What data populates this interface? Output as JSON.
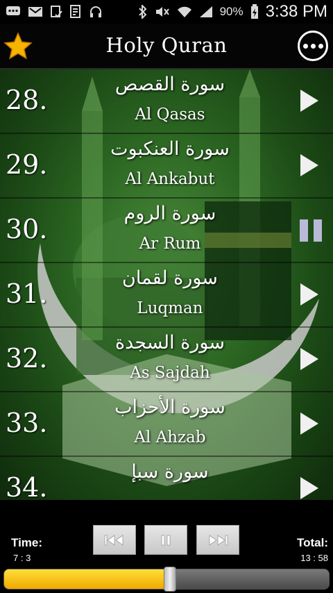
{
  "status_bar": {
    "left_icons": [
      "chat-icon",
      "gmail-icon",
      "task-icon",
      "document-icon",
      "headphones-icon"
    ],
    "right_icons": [
      "bluetooth-icon",
      "mute-icon",
      "wifi-icon",
      "signal-icon",
      "battery-icon"
    ],
    "battery": "90%",
    "time": "3:38 PM"
  },
  "app_bar": {
    "title": "Holy Quran",
    "favorite_icon": "star-icon",
    "more_icon": "more-options-icon",
    "accent_color": "#f6b300"
  },
  "surahs": [
    {
      "number": "28.",
      "arabic": "سورة القصص",
      "english": "Al Qasas",
      "state": "play"
    },
    {
      "number": "29.",
      "arabic": "سورة العنكبوت",
      "english": "Al Ankabut",
      "state": "play"
    },
    {
      "number": "30.",
      "arabic": "سورة الروم",
      "english": "Ar Rum",
      "state": "pause"
    },
    {
      "number": "31.",
      "arabic": "سورة لقمان",
      "english": "Luqman",
      "state": "play"
    },
    {
      "number": "32.",
      "arabic": "سورة السجدة",
      "english": "As Sajdah",
      "state": "play"
    },
    {
      "number": "33.",
      "arabic": "سورة الأحزاب",
      "english": "Al Ahzab",
      "state": "play"
    },
    {
      "number": "34.",
      "arabic": "سورة سبإ",
      "english": "",
      "state": "play"
    }
  ],
  "player": {
    "time_label": "Time:",
    "time_value": "7 : 3",
    "total_label": "Total:",
    "total_value": "13 : 58",
    "buttons": [
      "previous-icon",
      "pause-icon",
      "next-icon"
    ],
    "progress": 0.51,
    "progress_color": "#f8c300"
  }
}
